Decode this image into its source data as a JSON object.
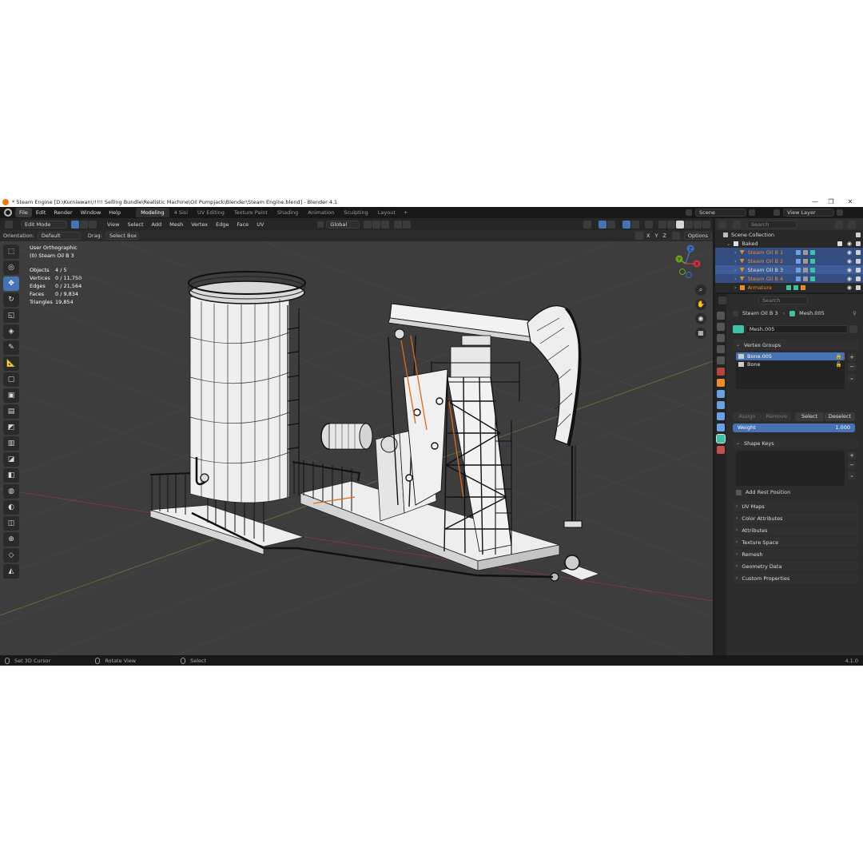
{
  "window": {
    "title": "* Steam Engine [D:\\Kurniawan\\!!!!! Selling Bundle\\Realistic Machine\\Oil Pumpjack\\Blender\\Steam Engine.blend] - Blender 4.1",
    "controls": [
      "—",
      "❐",
      "✕"
    ]
  },
  "menu": {
    "items": [
      "File",
      "Edit",
      "Render",
      "Window",
      "Help"
    ],
    "workspaces": [
      "Modeling",
      "4 Sisi",
      "UV Editing",
      "Texture Paint",
      "Shading",
      "Animation",
      "Sculpting",
      "Layout"
    ],
    "add_workspace": "+",
    "scene": "Scene",
    "view_layer": "View Layer"
  },
  "viewport_header": {
    "mode": "Edit Mode",
    "menus": [
      "View",
      "Select",
      "Add",
      "Mesh",
      "Vertex",
      "Edge",
      "Face",
      "UV"
    ],
    "transform": "Global",
    "orientation_label": "Orientation:",
    "orientation_value": "Default",
    "drag_label": "Drag:",
    "drag_value": "Select Box",
    "axes": [
      "X",
      "Y",
      "Z"
    ],
    "options": "Options"
  },
  "overlay": {
    "view_name": "User Orthographic",
    "object_name": "(0) Steam Oil B 3",
    "stats": [
      {
        "label": "Objects",
        "value": "4 / 5"
      },
      {
        "label": "Vertices",
        "value": "0 / 11,750"
      },
      {
        "label": "Edges",
        "value": "0 / 21,564"
      },
      {
        "label": "Faces",
        "value": "0 / 9,834"
      },
      {
        "label": "Triangles",
        "value": "19,854"
      }
    ]
  },
  "gizmo": {
    "x": "X",
    "y": "Y",
    "z": "Z"
  },
  "outliner": {
    "search_placeholder": "Search",
    "scene_collection": "Scene Collection",
    "collection": "Baked",
    "items": [
      {
        "name": "Steam Oil B 1",
        "selected": true
      },
      {
        "name": "Steam Oil B 2",
        "selected": true
      },
      {
        "name": "Steam Oil B 3",
        "selected": true
      },
      {
        "name": "Steam Oil B 4",
        "selected": true
      },
      {
        "name": "Armature",
        "selected": false
      }
    ]
  },
  "properties": {
    "search_placeholder": "Search",
    "breadcrumb_object": "Steam Oil B 3",
    "breadcrumb_mesh": "Mesh.005",
    "mesh_name": "Mesh.005",
    "vertex_groups_title": "Vertex Groups",
    "vertex_groups": [
      {
        "name": "Bone.005",
        "selected": true
      },
      {
        "name": "Bone",
        "selected": false
      }
    ],
    "buttons": {
      "assign": "Assign",
      "remove": "Remove",
      "select": "Select",
      "deselect": "Deselect"
    },
    "weight_label": "Weight",
    "weight_value": "1.000",
    "shape_keys_title": "Shape Keys",
    "add_rest_position": "Add Rest Position",
    "panels": [
      "UV Maps",
      "Color Attributes",
      "Attributes",
      "Texture Space",
      "Remesh",
      "Geometry Data",
      "Custom Properties"
    ]
  },
  "status": {
    "items": [
      "Set 3D Cursor",
      "Rotate View",
      "Select"
    ],
    "version": "4.1.0"
  },
  "colors": {
    "accent_blue": "#4772b3",
    "selected_row": "#334d80",
    "object_orange": "#e98c2a",
    "viewport_bg": "#3d3d3d"
  }
}
